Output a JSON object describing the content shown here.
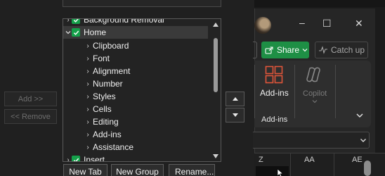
{
  "dialog": {
    "add_button": "Add >>",
    "remove_button": "<< Remove",
    "tree": [
      {
        "label": "Background Removal",
        "kind": "tab",
        "checked": true,
        "expanded": false
      },
      {
        "label": "Home",
        "kind": "tab",
        "checked": true,
        "expanded": true,
        "selected": true
      },
      {
        "label": "Clipboard",
        "kind": "group"
      },
      {
        "label": "Font",
        "kind": "group"
      },
      {
        "label": "Alignment",
        "kind": "group"
      },
      {
        "label": "Number",
        "kind": "group"
      },
      {
        "label": "Styles",
        "kind": "group"
      },
      {
        "label": "Cells",
        "kind": "group"
      },
      {
        "label": "Editing",
        "kind": "group"
      },
      {
        "label": "Add-ins",
        "kind": "group"
      },
      {
        "label": "Assistance",
        "kind": "group"
      },
      {
        "label": "Insert",
        "kind": "tab",
        "checked": true,
        "expanded": false
      }
    ],
    "new_tab_button": "New Tab",
    "new_group_button": "New Group",
    "rename_button": "Rename..."
  },
  "excel": {
    "minimize_glyph": "–",
    "restore_glyph": "☐",
    "close_glyph": "✕",
    "share_label": "Share",
    "catchup_label": "Catch up",
    "addins_button_label": "Add-ins",
    "addins_group_label": "Add-ins",
    "copilot_label": "Copilot",
    "columns": [
      "Z",
      "AA",
      "AE"
    ]
  },
  "colors": {
    "checkbox": "#15a04a",
    "share_button": "#1e8f45",
    "addins_icon": "#e0553a"
  }
}
